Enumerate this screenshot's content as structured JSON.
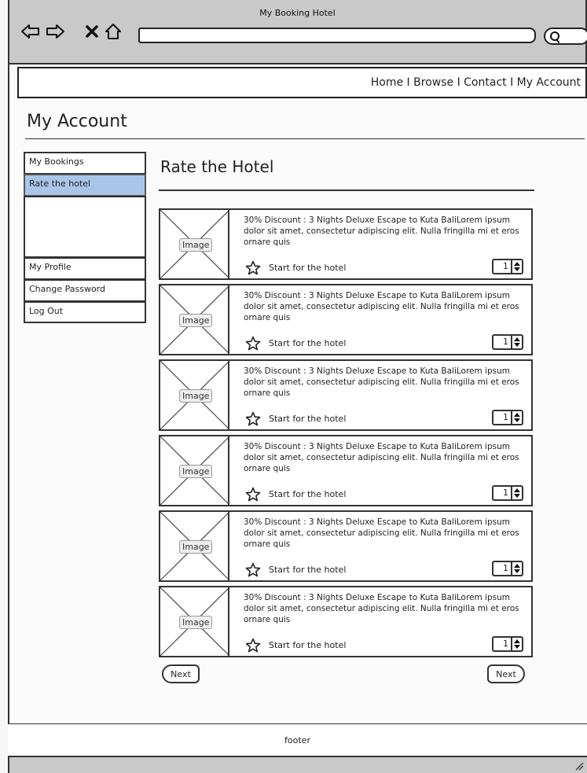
{
  "browser": {
    "title": "My Booking Hotel",
    "url": ""
  },
  "topnav": {
    "items": [
      "Home",
      "Browse",
      "Contact",
      "My Account"
    ],
    "separator": " I "
  },
  "page": {
    "heading": "My Account"
  },
  "sidebar": {
    "items": [
      {
        "label": "My Bookings",
        "active": false
      },
      {
        "label": "Rate the hotel",
        "active": true
      },
      {
        "label": "My Profile",
        "active": false
      },
      {
        "label": "Change Password",
        "active": false
      },
      {
        "label": "Log Out",
        "active": false
      }
    ]
  },
  "main": {
    "title": "Rate the Hotel",
    "cards": [
      {
        "image_label": "Image",
        "description": "30% Discount : 3 Nights Deluxe Escape to Kuta BaliLorem ipsum dolor sit amet, consectetur adipiscing elit. Nulla fringilla mi et eros ornare quis",
        "rating_label": "Start for the hotel",
        "rating_value": "1"
      },
      {
        "image_label": "Image",
        "description": "30% Discount : 3 Nights Deluxe Escape to Kuta BaliLorem ipsum dolor sit amet, consectetur adipiscing elit. Nulla fringilla mi et eros ornare quis",
        "rating_label": "Start for the hotel",
        "rating_value": "1"
      },
      {
        "image_label": "Image",
        "description": "30% Discount : 3 Nights Deluxe Escape to Kuta BaliLorem ipsum dolor sit amet, consectetur adipiscing elit. Nulla fringilla mi et eros ornare quis",
        "rating_label": "Start for the hotel",
        "rating_value": "1"
      },
      {
        "image_label": "Image",
        "description": "30% Discount : 3 Nights Deluxe Escape to Kuta BaliLorem ipsum dolor sit amet, consectetur adipiscing elit. Nulla fringilla mi et eros ornare quis",
        "rating_label": "Start for the hotel",
        "rating_value": "1"
      },
      {
        "image_label": "Image",
        "description": "30% Discount : 3 Nights Deluxe Escape to Kuta BaliLorem ipsum dolor sit amet, consectetur adipiscing elit. Nulla fringilla mi et eros ornare quis",
        "rating_label": "Start for the hotel",
        "rating_value": "1"
      },
      {
        "image_label": "Image",
        "description": "30% Discount : 3 Nights Deluxe Escape to Kuta BaliLorem ipsum dolor sit amet, consectetur adipiscing elit. Nulla fringilla mi et eros ornare quis",
        "rating_label": "Start for the hotel",
        "rating_value": "1"
      }
    ],
    "pagination": {
      "prev_label": "Next",
      "next_label": "Next"
    }
  },
  "footer": {
    "text": "footer"
  },
  "icons": {
    "back": "back-arrow-icon",
    "forward": "forward-arrow-icon",
    "stop": "close-icon",
    "home": "home-icon",
    "search": "search-icon",
    "star": "star-icon",
    "resize": "resize-grip-icon"
  },
  "colors": {
    "chrome": "#c9c9c9",
    "active_sidebar": "#a9c6ea",
    "border": "#333333"
  }
}
